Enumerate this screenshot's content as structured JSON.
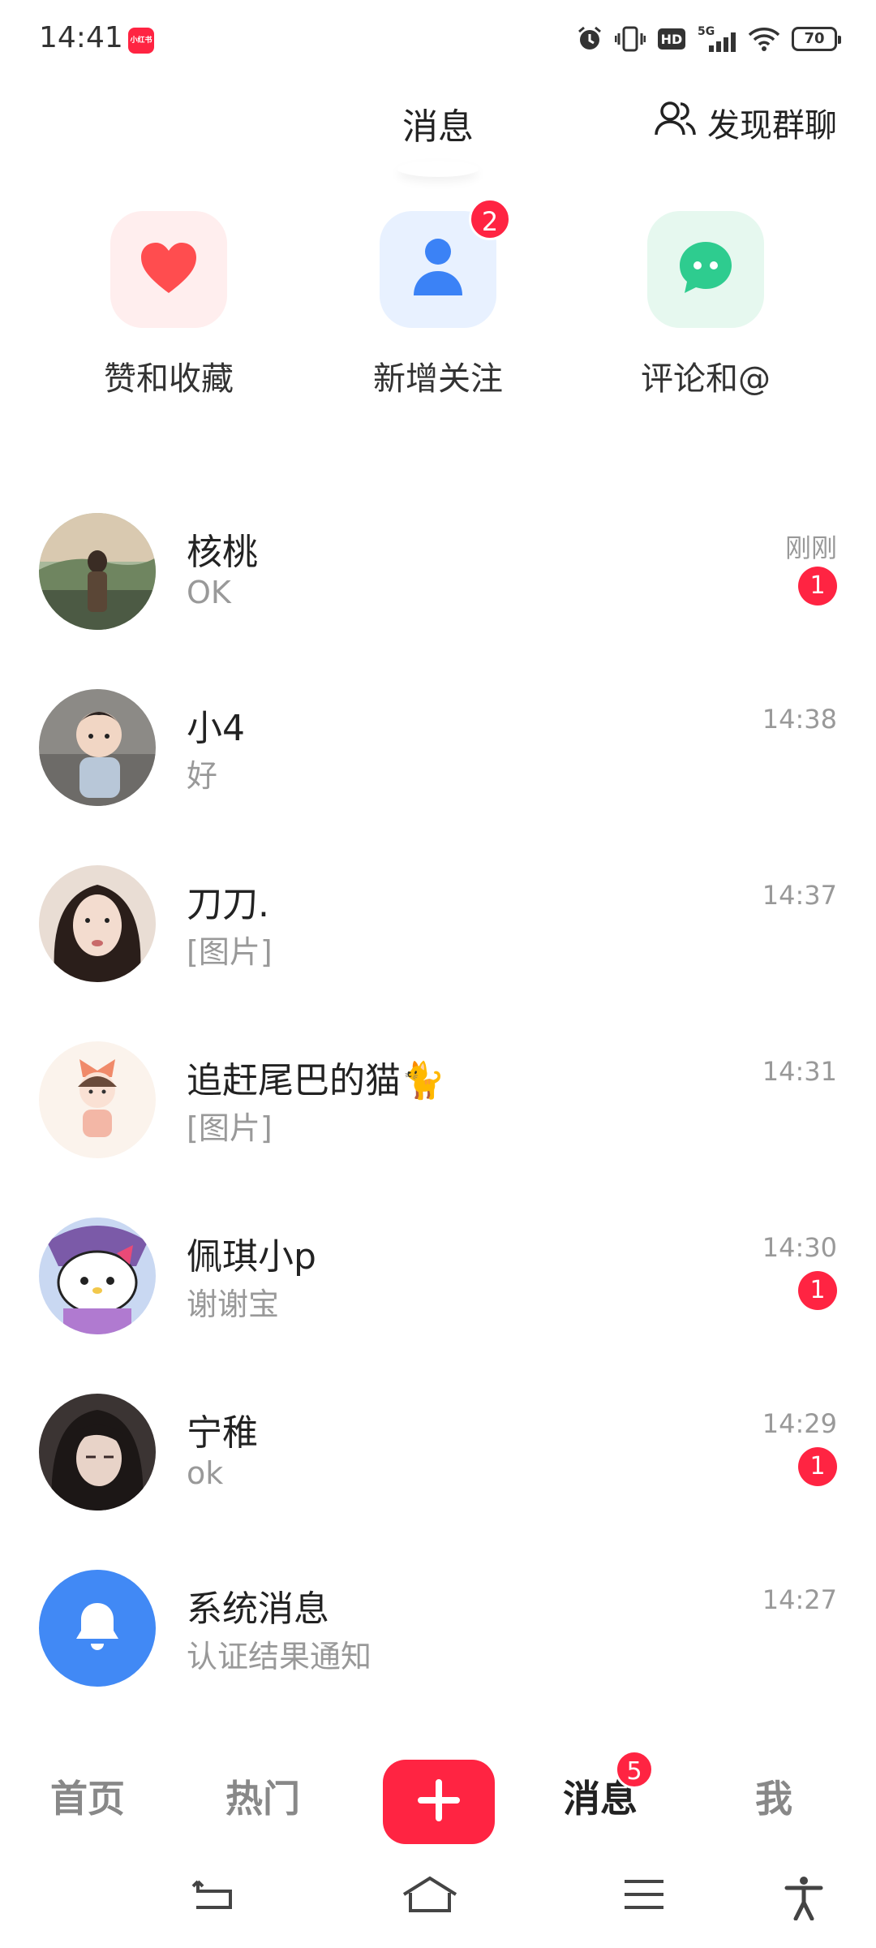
{
  "status_bar": {
    "time": "14:41",
    "app_icon_text": "小红书",
    "battery": "70",
    "network": "5G",
    "icons": [
      "alarm-icon",
      "vibrate-icon",
      "hd-icon",
      "signal-icon",
      "wifi-icon",
      "battery-icon"
    ]
  },
  "header": {
    "title": "消息",
    "discover_label": "发现群聊",
    "discover_icon": "group-icon"
  },
  "quick_entries": [
    {
      "label": "赞和收藏",
      "icon": "heart-icon",
      "bg": "#ffeeee",
      "color": "#ff4d4f"
    },
    {
      "label": "新增关注",
      "icon": "person-icon",
      "bg": "#e8f1ff",
      "color": "#3b82f6",
      "badge": "2"
    },
    {
      "label": "评论和@",
      "icon": "comment-icon",
      "bg": "#e6f8ef",
      "color": "#2ecc8f"
    }
  ],
  "chats": [
    {
      "name": "核桃",
      "message": "OK",
      "time": "刚刚",
      "badge": "1"
    },
    {
      "name": "小4",
      "message": "好",
      "time": "14:38"
    },
    {
      "name": "刀刀.",
      "message": "[图片]",
      "time": "14:37"
    },
    {
      "name": "追赶尾巴的猫🐈",
      "message": "[图片]",
      "time": "14:31"
    },
    {
      "name": "佩琪小p",
      "message": "谢谢宝",
      "time": "14:30",
      "badge": "1"
    },
    {
      "name": "宁稚",
      "message": "ok",
      "time": "14:29",
      "badge": "1"
    },
    {
      "name": "系统消息",
      "message": "认证结果通知",
      "time": "14:27"
    }
  ],
  "tabbar": {
    "home": "首页",
    "hot": "热门",
    "plus_icon": "plus-icon",
    "messages": "消息",
    "messages_badge": "5",
    "me": "我"
  },
  "colors": {
    "brand": "#ff2442",
    "text": "#222222",
    "muted": "#999999"
  }
}
